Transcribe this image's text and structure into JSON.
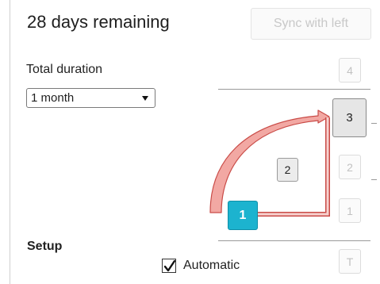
{
  "header": {
    "title": "28 days remaining",
    "sync_button": "Sync with left"
  },
  "duration": {
    "label": "Total duration",
    "selected": "1 month"
  },
  "setup": {
    "label": "Setup",
    "automatic_label": "Automatic",
    "automatic_checked": true
  },
  "levels": {
    "right": {
      "l4": "4",
      "l3": "3",
      "l2": "2",
      "l1": "1",
      "lt": "T"
    },
    "center_l2": "2",
    "current_l1": "1"
  },
  "colors": {
    "current": "#1cb3cf",
    "arrow_fill": "#f2a8a3",
    "arrow_stroke": "#c94b47"
  }
}
